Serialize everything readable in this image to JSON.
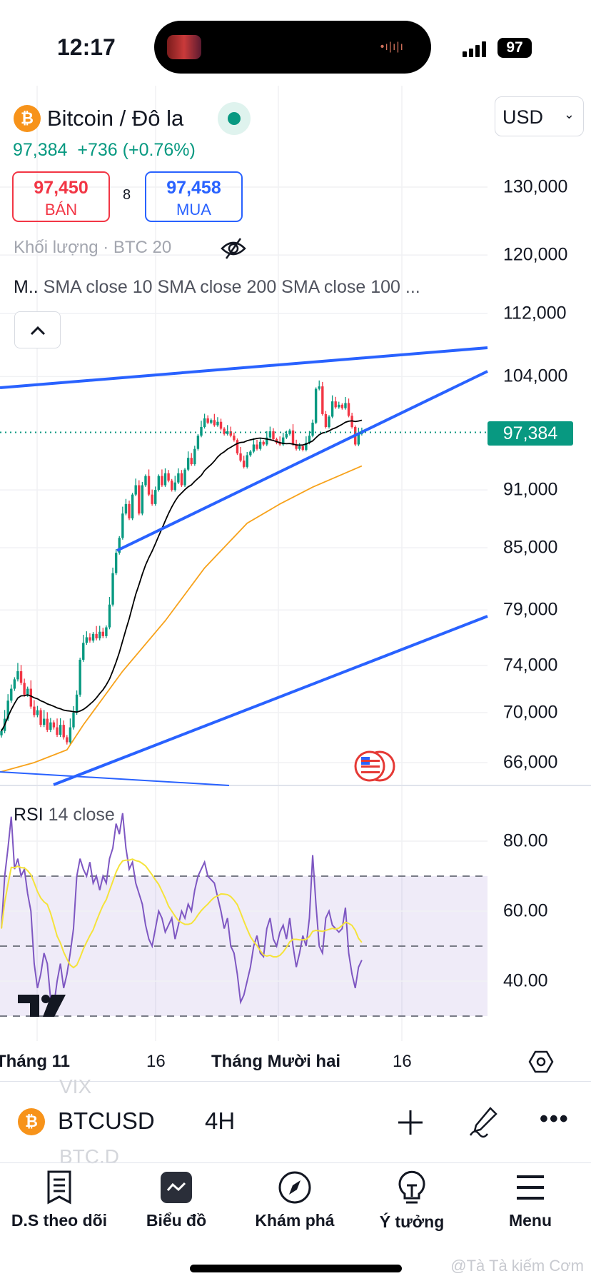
{
  "status_bar": {
    "time": "12:17",
    "battery": "97"
  },
  "header": {
    "title": "Bitcoin / Đô la",
    "currency": "USD",
    "last_price": "97,384",
    "change": "+736",
    "change_pct": "(+0.76%)",
    "sell_price": "97,450",
    "sell_label": "BÁN",
    "spread": "8",
    "buy_price": "97,458",
    "buy_label": "MUA",
    "volume_label": "Khối lượng · BTC 20",
    "indicators_prefix": "M..",
    "indicators": "SMA close 10 SMA close 200 SMA close 100 ..."
  },
  "rsi_pane": {
    "name": "RSI",
    "params": "14 close",
    "axis": [
      "80.00",
      "60.00",
      "40.00"
    ]
  },
  "time_axis": {
    "labels": [
      "Tháng 11",
      "16",
      "Tháng Mười hai",
      "16"
    ]
  },
  "toolbar": {
    "symbol": "BTCUSD",
    "interval": "4H",
    "ghost_above": "VIX",
    "ghost_below": "BTC.D"
  },
  "nav": [
    {
      "label": "D.S theo dõi",
      "icon": "watchlist-icon"
    },
    {
      "label": "Biểu đồ",
      "icon": "chart-icon"
    },
    {
      "label": "Khám phá",
      "icon": "compass-icon"
    },
    {
      "label": "Ý tưởng",
      "icon": "lightbulb-icon"
    },
    {
      "label": "Menu",
      "icon": "menu-icon"
    }
  ],
  "watermark": "@Tà Tà kiếm Cơm",
  "colors": {
    "up": "#089981",
    "down": "#f23645",
    "trend": "#2962ff",
    "sma_fast": "#000000",
    "sma_slow": "#f7a21b",
    "rsi": "#7e57c2",
    "rsi_ma": "#f5e33b"
  },
  "chart_data": {
    "type": "candlestick",
    "symbol": "BTCUSD",
    "interval": "4H",
    "y_scale": "log",
    "y_ticks": [
      130000,
      120000,
      112000,
      104000,
      91000,
      85000,
      79000,
      74000,
      70000,
      66000
    ],
    "y_tick_labels": [
      "130,000",
      "120,000",
      "112,000",
      "104,000",
      "91,000",
      "85,000",
      "79,000",
      "74,000",
      "70,000",
      "66,000"
    ],
    "last_price": 97384,
    "last_price_label": "97,384",
    "closes": [
      68500,
      69500,
      71000,
      72000,
      72800,
      73500,
      72500,
      71500,
      72000,
      70500,
      69800,
      70200,
      69000,
      69500,
      68600,
      69200,
      68800,
      68200,
      69000,
      68000,
      67600,
      68800,
      70000,
      71500,
      74500,
      76000,
      76500,
      76200,
      76800,
      76400,
      77000,
      76600,
      77400,
      79500,
      82500,
      84500,
      86000,
      88500,
      89500,
      88000,
      90500,
      91500,
      88500,
      91500,
      92500,
      90500,
      89500,
      91000,
      92500,
      91500,
      92800,
      92000,
      91000,
      91800,
      92800,
      91500,
      93200,
      94500,
      93800,
      95500,
      97000,
      98000,
      99000,
      98500,
      98800,
      98200,
      98600,
      97800,
      97200,
      97500,
      97000,
      96500,
      95000,
      94200,
      93500,
      94800,
      95200,
      96000,
      95500,
      96300,
      96000,
      96800,
      97500,
      96600,
      96200,
      96000,
      96800,
      97200,
      97600,
      96000,
      95500,
      95800,
      95400,
      96200,
      97000,
      98500,
      102500,
      102800,
      99500,
      98000,
      99200,
      101000,
      100300,
      100600,
      100200,
      100800,
      99300,
      98000,
      96000,
      97200,
      97384
    ],
    "sma_fast_period": 20,
    "sma_slow_points": [
      [
        0,
        65300
      ],
      [
        10,
        66000
      ],
      [
        20,
        67000
      ],
      [
        25,
        69000
      ],
      [
        37,
        73500
      ],
      [
        50,
        78000
      ],
      [
        62,
        83000
      ],
      [
        75,
        87500
      ],
      [
        85,
        89500
      ],
      [
        95,
        91300
      ],
      [
        110,
        93600
      ]
    ],
    "rsi": {
      "period": 14,
      "overbought": 70,
      "middle": 50,
      "oversold": 30,
      "ma_period": 14,
      "values": [
        55,
        70,
        78,
        87,
        72,
        75,
        70,
        72,
        65,
        60,
        45,
        38,
        42,
        48,
        45,
        35,
        33,
        40,
        45,
        38,
        42,
        48,
        55,
        70,
        75,
        72,
        70,
        74,
        68,
        70,
        66,
        70,
        68,
        75,
        78,
        85,
        82,
        88,
        78,
        72,
        74,
        68,
        65,
        62,
        56,
        52,
        50,
        55,
        60,
        58,
        54,
        56,
        58,
        52,
        56,
        60,
        58,
        62,
        60,
        66,
        70,
        72,
        74,
        70,
        69,
        68,
        64,
        60,
        55,
        58,
        50,
        48,
        42,
        34,
        36,
        40,
        44,
        50,
        53,
        48,
        47,
        55,
        58,
        52,
        50,
        54,
        56,
        52,
        58,
        50,
        44,
        48,
        53,
        50,
        58,
        76,
        62,
        50,
        48,
        58,
        60,
        56,
        55,
        54,
        55,
        61,
        48,
        42,
        38,
        44,
        46
      ]
    }
  }
}
